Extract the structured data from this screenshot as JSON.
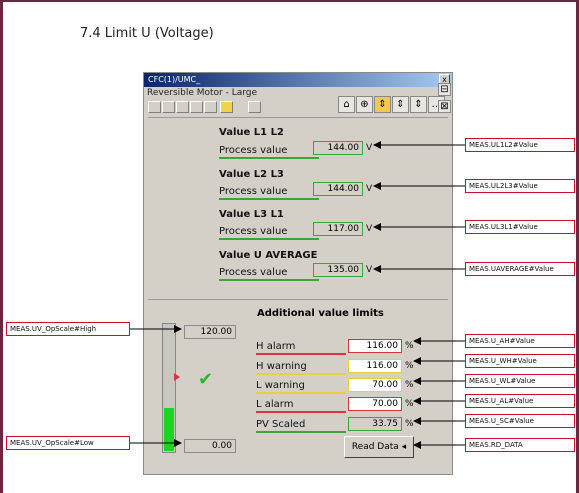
{
  "document": {
    "heading": "7.4  Limit U (Voltage)"
  },
  "window": {
    "title": "CFC(1)/UMC_",
    "subtitle": "Reversible Motor - Large",
    "close_label": "x"
  },
  "measurements": [
    {
      "group": "Value L1 L2",
      "label": "Process value",
      "value": "144.00",
      "unit": "V",
      "tag": "MEAS.UL1L2#Value"
    },
    {
      "group": "Value L2 L3",
      "label": "Process value",
      "value": "144.00",
      "unit": "V",
      "tag": "MEAS.UL2L3#Value"
    },
    {
      "group": "Value L3 L1",
      "label": "Process value",
      "value": "117.00",
      "unit": "V",
      "tag": "MEAS.UL3L1#Value"
    },
    {
      "group": "Value U AVERAGE",
      "label": "Process value",
      "value": "135.00",
      "unit": "V",
      "tag": "MEAS.UAVERAGE#Value"
    }
  ],
  "limits": {
    "title": "Additional value limits",
    "items": [
      {
        "label": "H alarm",
        "value": "116.00",
        "unit": "%",
        "tag": "MEAS.U_AH#Value",
        "color": "#d9343b"
      },
      {
        "label": "H warning",
        "value": "116.00",
        "unit": "%",
        "tag": "MEAS.U_WH#Value",
        "color": "#e6d23a"
      },
      {
        "label": "L warning",
        "value": "70.00",
        "unit": "%",
        "tag": "MEAS.U_WL#Value",
        "color": "#e6d23a"
      },
      {
        "label": "L alarm",
        "value": "70.00",
        "unit": "%",
        "tag": "MEAS.U_AL#Value",
        "color": "#d9343b"
      },
      {
        "label": "PV Scaled",
        "value": "33.75",
        "unit": "%",
        "tag": "MEAS.U_SC#Value",
        "color": "#3aa53a"
      }
    ]
  },
  "scale": {
    "high_value": "120.00",
    "low_value": "0.00",
    "high_tag": "MEAS.UV_OpScale#High",
    "low_tag": "MEAS.UV_OpScale#Low",
    "bar_fill_fraction": 0.3375,
    "bar_color": "#1ed41e"
  },
  "read_button": {
    "label": "Read Data",
    "tag": "MEAS.RD_DATA"
  },
  "colors": {
    "frame": "#6b2740",
    "callout_border": "#c8102e",
    "ok_check": "#2db82d"
  }
}
